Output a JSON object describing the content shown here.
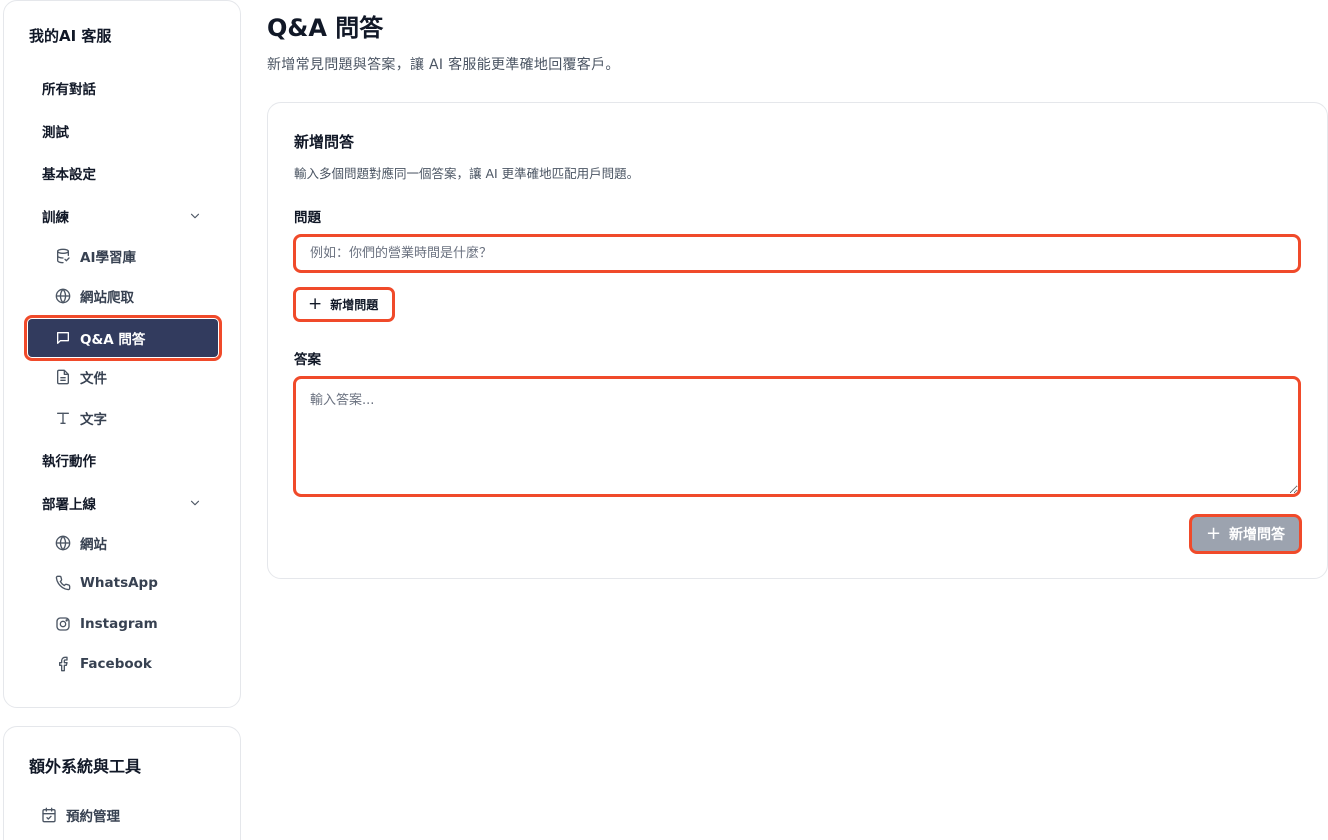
{
  "sidebar": {
    "title": "我的AI 客服",
    "items": [
      {
        "label": "所有對話"
      },
      {
        "label": "測試"
      },
      {
        "label": "基本設定"
      },
      {
        "label": "訓練"
      },
      {
        "label": "AI學習庫",
        "icon": "database-icon"
      },
      {
        "label": "網站爬取",
        "icon": "globe-icon"
      },
      {
        "label": "Q&A 問答",
        "icon": "chat-bubble-icon",
        "active": true
      },
      {
        "label": "文件",
        "icon": "document-icon"
      },
      {
        "label": "文字",
        "icon": "text-icon"
      },
      {
        "label": "執行動作"
      },
      {
        "label": "部署上線"
      },
      {
        "label": "網站",
        "icon": "globe-icon"
      },
      {
        "label": "WhatsApp",
        "icon": "phone-icon"
      },
      {
        "label": "Instagram",
        "icon": "instagram-icon"
      },
      {
        "label": "Facebook",
        "icon": "facebook-icon"
      }
    ]
  },
  "sidebar2": {
    "title": "額外系統與工具",
    "items": [
      {
        "label": "預約管理",
        "icon": "calendar-check-icon"
      }
    ]
  },
  "page": {
    "title": "Q&A 問答",
    "subtitle": "新增常見問題與答案，讓 AI 客服能更準確地回覆客戶。"
  },
  "form": {
    "title": "新增問答",
    "description": "輸入多個問題對應同一個答案，讓 AI 更準確地匹配用戶問題。",
    "question_label": "問題",
    "question_placeholder": "例如：你們的營業時間是什麼？",
    "add_question_label": "新增問題",
    "answer_label": "答案",
    "answer_placeholder": "輸入答案...",
    "submit_label": "新增問答"
  },
  "colors": {
    "active_nav_bg": "#323b5e",
    "highlight_border": "#f04a2a",
    "disabled_button_bg": "#9ca3af"
  }
}
